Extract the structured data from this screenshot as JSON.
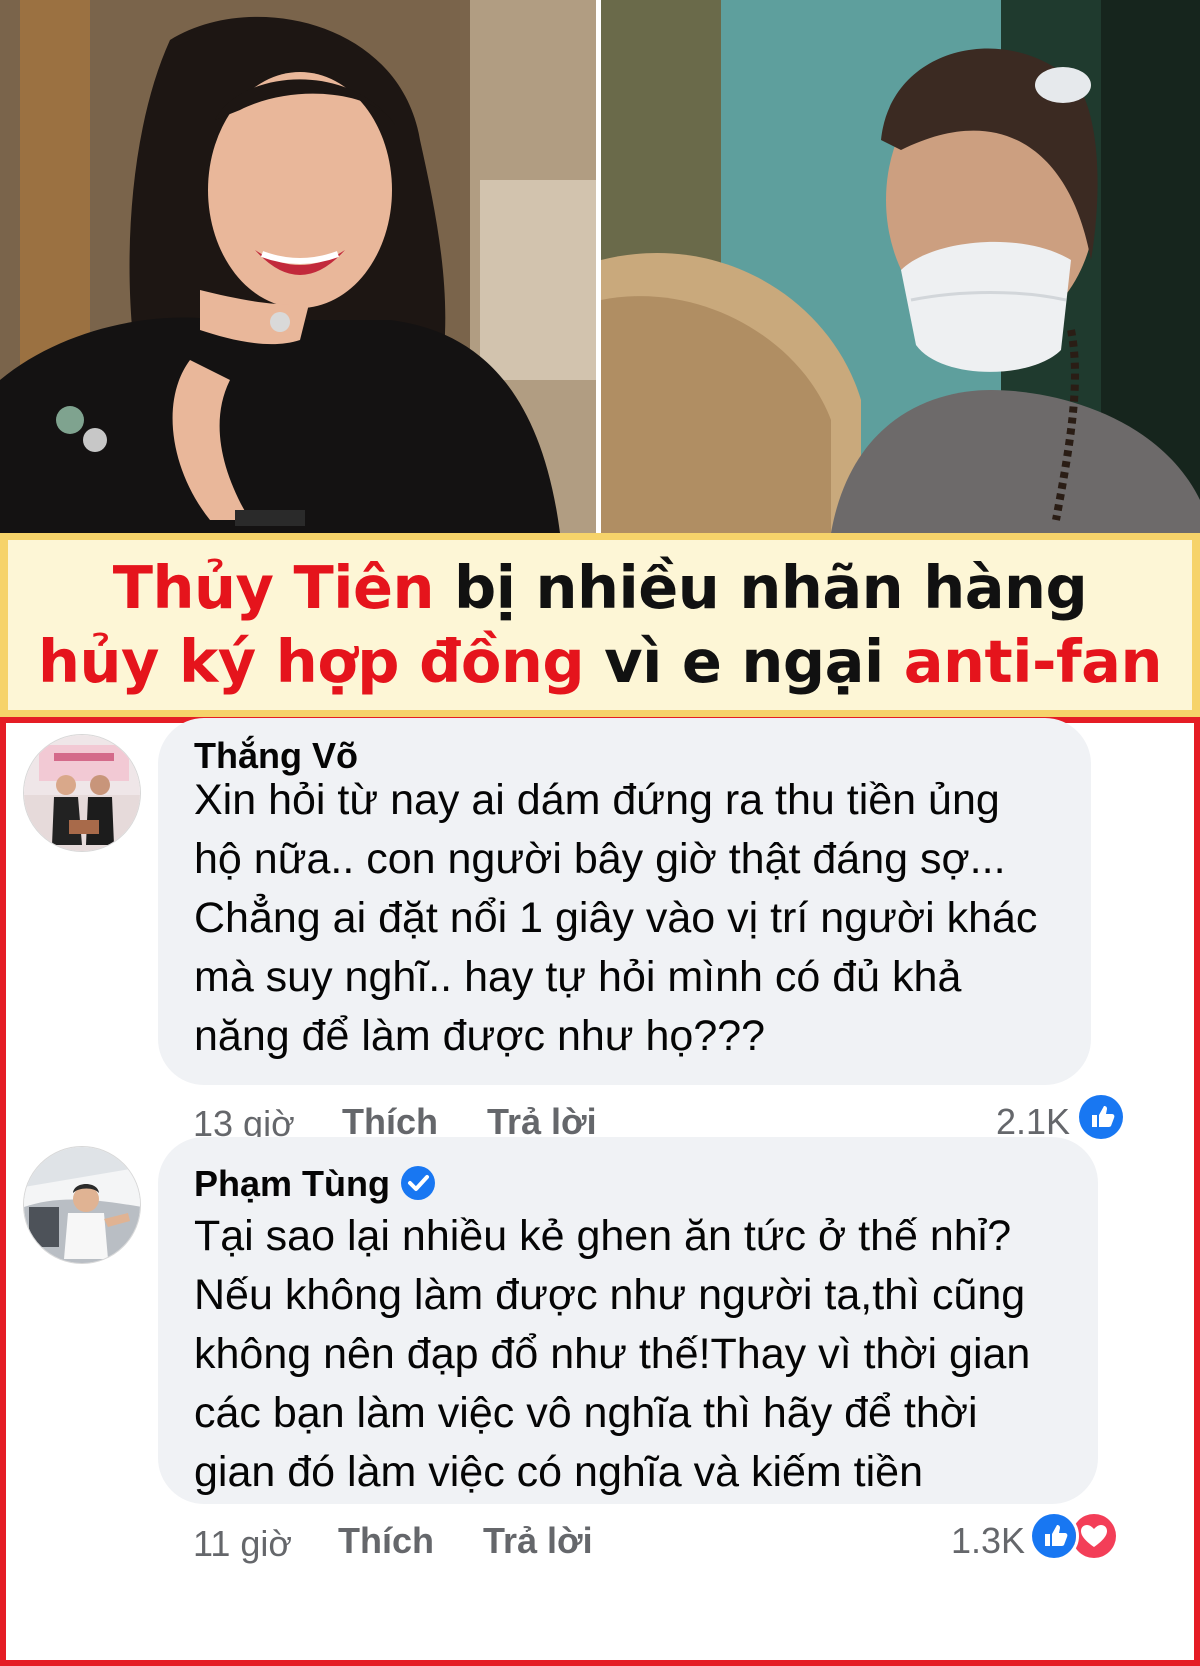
{
  "headline": {
    "line1": {
      "name": "Thủy Tiên",
      "rest": " bị nhiều nhãn hàng"
    },
    "line2": {
      "phrase": "hủy ký hợp đồng",
      "middle": " vì e ngại ",
      "end": "anti-fan"
    }
  },
  "colors": {
    "headline_accent": "#e5141c",
    "banner_border": "#f6d36a",
    "banner_fill": "#fdf6d6",
    "panel_border": "#e51d25",
    "bubble": "#f0f2f5",
    "like_blue": "#1877f2",
    "love_red": "#f33e58"
  },
  "comments": [
    {
      "author": "Thắng Võ",
      "verified": false,
      "text": "Xin hỏi từ nay ai dám đứng ra thu tiền ủng\nhộ nữa.. con người bây giờ thật đáng sợ...\nChẳng ai đặt nổi 1 giây vào vị trí người khác\nmà suy nghĩ.. hay tự hỏi mình có đủ khả\nnăng để làm được như họ???",
      "time": "13 giờ",
      "like_label": "Thích",
      "reply_label": "Trả lời",
      "reaction_count": "2.1K",
      "reactions": [
        "like-icon"
      ]
    },
    {
      "author": "Phạm Tùng",
      "verified": true,
      "text": "Tại sao lại nhiều kẻ ghen ăn tức ở thế nhỉ?\nNếu không làm được như người ta,thì cũng\nkhông nên đạp đổ như thế!Thay vì thời gian\ncác bạn làm việc vô nghĩa thì hãy để thời\ngian đó làm việc có nghĩa và kiếm tiền",
      "time": "11 giờ",
      "like_label": "Thích",
      "reply_label": "Trả lời",
      "reaction_count": "1.3K",
      "reactions": [
        "like-icon",
        "love-icon"
      ]
    }
  ]
}
